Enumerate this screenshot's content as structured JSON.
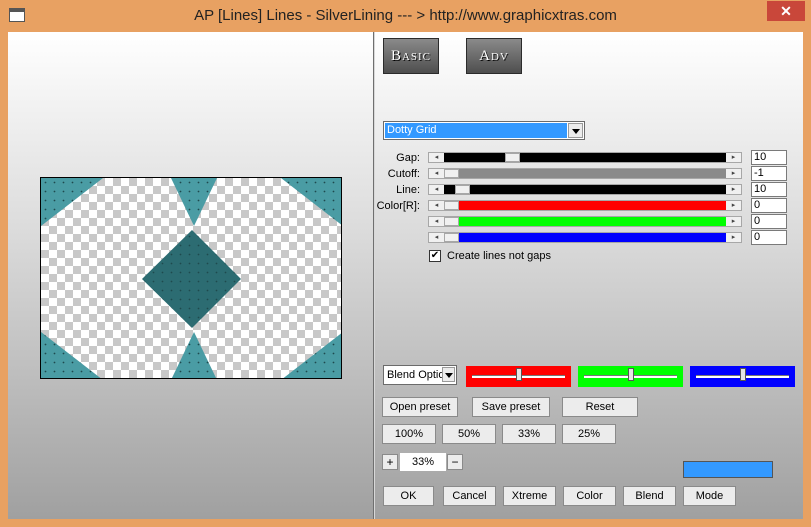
{
  "window": {
    "title": "AP [Lines]  Lines - SilverLining     --- > http://www.graphicxtras.com",
    "close_glyph": "✕"
  },
  "tabs": {
    "basic": "Basic",
    "adv": "Adv"
  },
  "effect_dropdown": {
    "value": "Dotty Grid"
  },
  "sliders": [
    {
      "label": "Gap:",
      "value": "10",
      "fill": 0.23,
      "track_color": "#000000"
    },
    {
      "label": "Cutoff:",
      "value": "-1",
      "fill": 0.0,
      "track_color": "#8a8a8a"
    },
    {
      "label": "Line:",
      "value": "10",
      "fill": 0.04,
      "track_color": "#000000"
    },
    {
      "label": "Color[R]:",
      "value": "0",
      "fill": 0.0,
      "track_color": "#ff0000"
    },
    {
      "label": "",
      "value": "0",
      "fill": 0.0,
      "track_color": "#00ff00"
    },
    {
      "label": "",
      "value": "0",
      "fill": 0.0,
      "track_color": "#0000ff"
    }
  ],
  "checkbox": {
    "label": "Create lines not gaps",
    "checked": true,
    "mark": "✔"
  },
  "blend": {
    "select_value": "Blend Optio",
    "color_sliders": [
      {
        "color": "#ff0000",
        "level": 0.5
      },
      {
        "color": "#00ff00",
        "level": 0.5
      },
      {
        "color": "#0000ff",
        "level": 0.5
      }
    ]
  },
  "preset_buttons": {
    "open": "Open preset",
    "save": "Save preset",
    "reset": "Reset"
  },
  "zoom_buttons": [
    "100%",
    "50%",
    "33%",
    "25%"
  ],
  "zoom_control": {
    "plus": "+",
    "value": "33%",
    "minus": "−"
  },
  "accent_color": "#3399ff",
  "preview": {
    "tile_color": "#4a9ca4",
    "diamond_color": "#2c6c72"
  },
  "bottom_buttons": {
    "ok": "OK",
    "cancel": "Cancel",
    "xtreme": "Xtreme",
    "color": "Color",
    "blend": "Blend",
    "mode": "Mode"
  },
  "icons": {
    "scroll_left": "◂",
    "scroll_right": "▸"
  }
}
